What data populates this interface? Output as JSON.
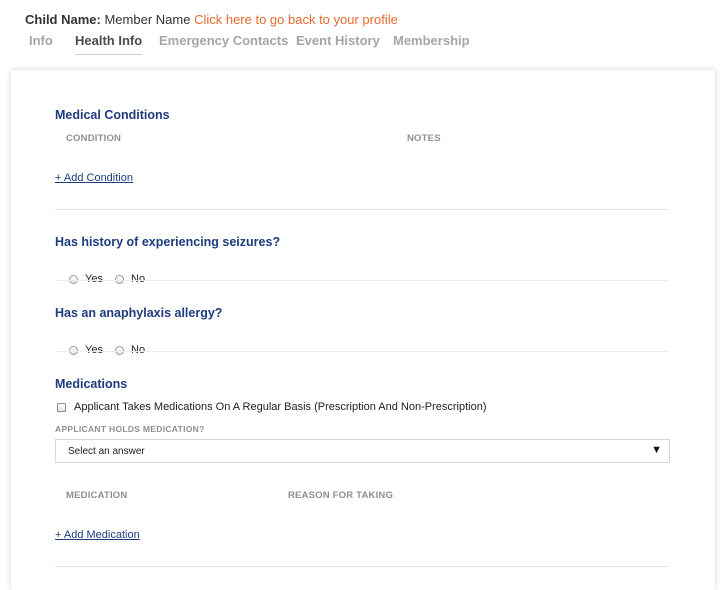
{
  "header": {
    "child_name_label": "Child Name:",
    "member_name": "Member Name",
    "back_link": "Click here to go back to your profile"
  },
  "tabs": [
    {
      "label": "Info",
      "active": false
    },
    {
      "label": "Health Info",
      "active": true
    },
    {
      "label": "Emergency Contacts",
      "active": false
    },
    {
      "label": "Event History",
      "active": false
    },
    {
      "label": "Membership",
      "active": false
    }
  ],
  "medical_conditions": {
    "title": "Medical Conditions",
    "col_condition": "CONDITION",
    "col_notes": "NOTES",
    "add_link": "+ Add Condition"
  },
  "seizures": {
    "question": "Has history of experiencing seizures?",
    "yes": "Yes",
    "no": "No"
  },
  "anaphylaxis": {
    "question": "Has an anaphylaxis allergy?",
    "yes": "Yes",
    "no": "No"
  },
  "medications": {
    "title": "Medications",
    "checkbox_label": "Applicant Takes Medications On A Regular Basis (Prescription And Non-Prescription)",
    "holds_label": "APPLICANT HOLDS MEDICATION?",
    "select_value": "Select an answer",
    "col_medication": "MEDICATION",
    "col_reason": "REASON FOR TAKING",
    "add_link": "+ Add Medication"
  },
  "colors": {
    "accent_link": "#e8692f",
    "section_title": "#1f3c7e"
  },
  "icons": {
    "select_arrow": "triangle-down-icon"
  }
}
